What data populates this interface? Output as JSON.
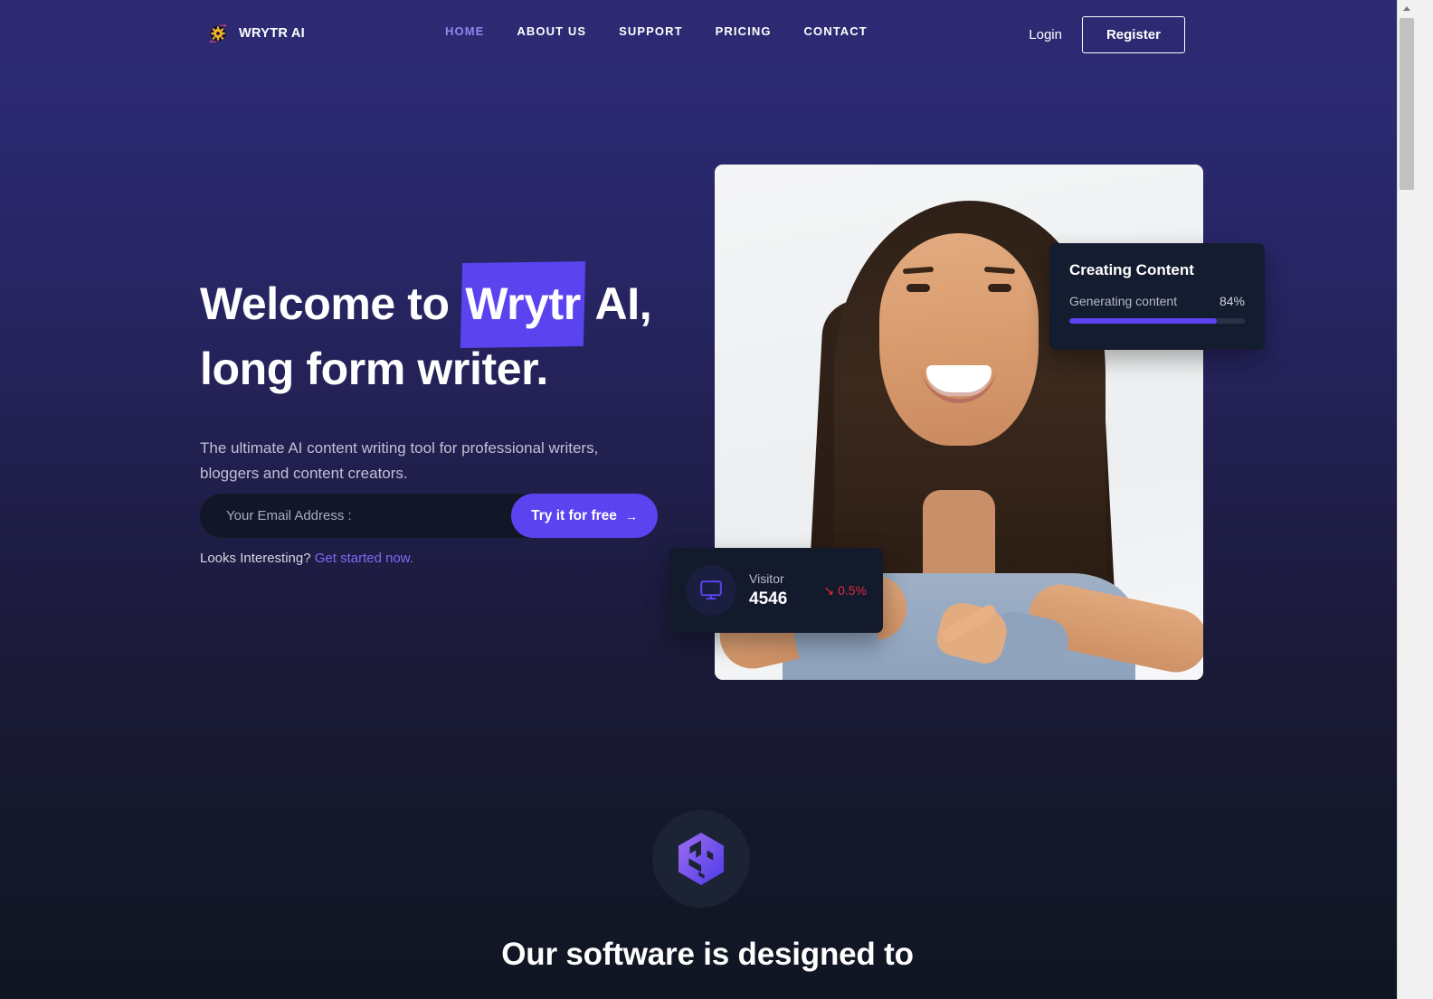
{
  "header": {
    "brand": {
      "name": "WRYTR AI",
      "icon": "gear-badge-icon"
    },
    "nav": [
      {
        "label": "HOME",
        "active": true
      },
      {
        "label": "ABOUT US",
        "active": false
      },
      {
        "label": "SUPPORT",
        "active": false
      },
      {
        "label": "PRICING",
        "active": false
      },
      {
        "label": "CONTACT",
        "active": false
      }
    ],
    "login_label": "Login",
    "register_label": "Register"
  },
  "hero": {
    "headline_pre": "Welcome to ",
    "headline_mark": "Wrytr",
    "headline_post": " AI,",
    "headline_line2": "long form writer.",
    "subhead": "The ultimate AI content writing tool for professional writers, bloggers and content creators.",
    "email_placeholder": "Your Email Address :",
    "email_value": "",
    "cta_label": "Try it for free",
    "cta_arrow": "→",
    "interest_text": "Looks Interesting?",
    "interest_link": "Get started now."
  },
  "creating_card": {
    "title": "Creating Content",
    "status_label": "Generating content",
    "percent_label": "84%",
    "percent_value": 84
  },
  "visitor_card": {
    "icon": "monitor-icon",
    "label": "Visitor",
    "value": "4546",
    "delta": "0.5%",
    "delta_arrow": "↘",
    "delta_direction": "down"
  },
  "lower_section": {
    "logo_icon": "hex-cube-logo-icon",
    "title": "Our software is designed to"
  },
  "colors": {
    "accent": "#5b43f0",
    "accent_light": "#8d87f0",
    "bg_top": "#2e2b74",
    "bg_bottom": "#101623",
    "card_bg": "#141c30",
    "danger": "#e0283f",
    "text_muted": "#bfc0d6"
  },
  "scrollbar": {
    "position": "right",
    "thumb_top_pct": 2
  }
}
